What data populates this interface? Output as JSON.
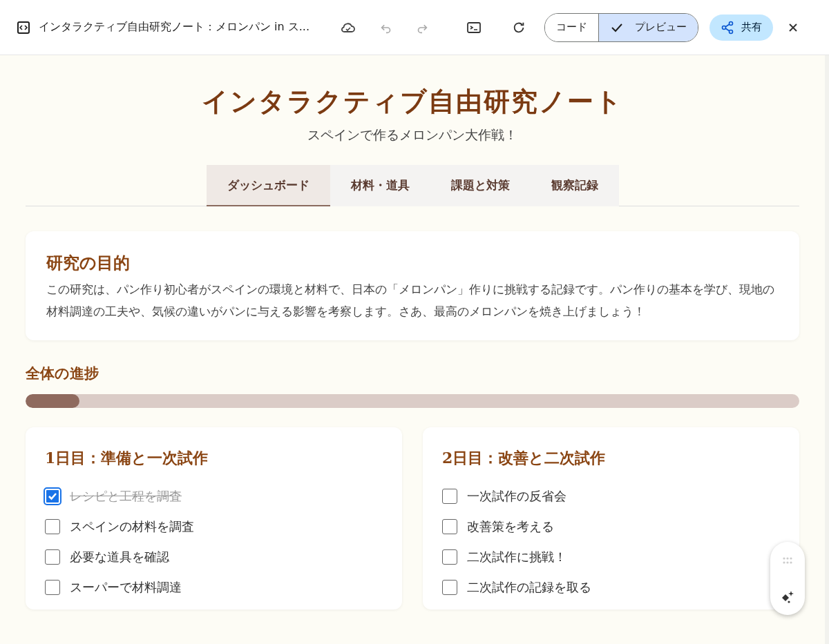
{
  "toolbar": {
    "title": "インタラクティブ自由研究ノート：メロンパン in ス...",
    "view_toggles": [
      {
        "label": "コード",
        "selected": false
      },
      {
        "label": "プレビュー",
        "selected": true
      }
    ],
    "share_button": "共有"
  },
  "header": {
    "title": "インタラクティブ自由研究ノート",
    "subtitle": "スペインで作るメロンパン大作戦！"
  },
  "tabs": [
    {
      "label": "ダッシュボード",
      "selected": true
    },
    {
      "label": "材料・道具",
      "selected": false
    },
    {
      "label": "課題と対策",
      "selected": false
    },
    {
      "label": "観察記録",
      "selected": false
    }
  ],
  "purpose": {
    "heading": "研究の目的",
    "text": "この研究は、パン作り初心者がスペインの環境と材料で、日本の「メロンパン」作りに挑戦する記録です。パン作りの基本を学び、現地の材料調達の工夫や、気候の違いがパンに与える影響を考察します。さあ、最高のメロンパンを焼き上げましょう！"
  },
  "progress": {
    "heading": "全体の進捗",
    "level": 0.07
  },
  "days": [
    {
      "heading": "1日目：準備と一次試作",
      "tasks": [
        {
          "label": "レシピと工程を調査",
          "checked": true
        },
        {
          "label": "スペインの材料を調査",
          "checked": false
        },
        {
          "label": "必要な道具を確認",
          "checked": false
        },
        {
          "label": "スーパーで材料調達",
          "checked": false
        }
      ]
    },
    {
      "heading": "2日目：改善と二次試作",
      "tasks": [
        {
          "label": "一次試作の反省会",
          "checked": false
        },
        {
          "label": "改善策を考える",
          "checked": false
        },
        {
          "label": "二次試作に挑戦！",
          "checked": false
        },
        {
          "label": "二次試作の記録を取る",
          "checked": false
        }
      ]
    }
  ]
}
